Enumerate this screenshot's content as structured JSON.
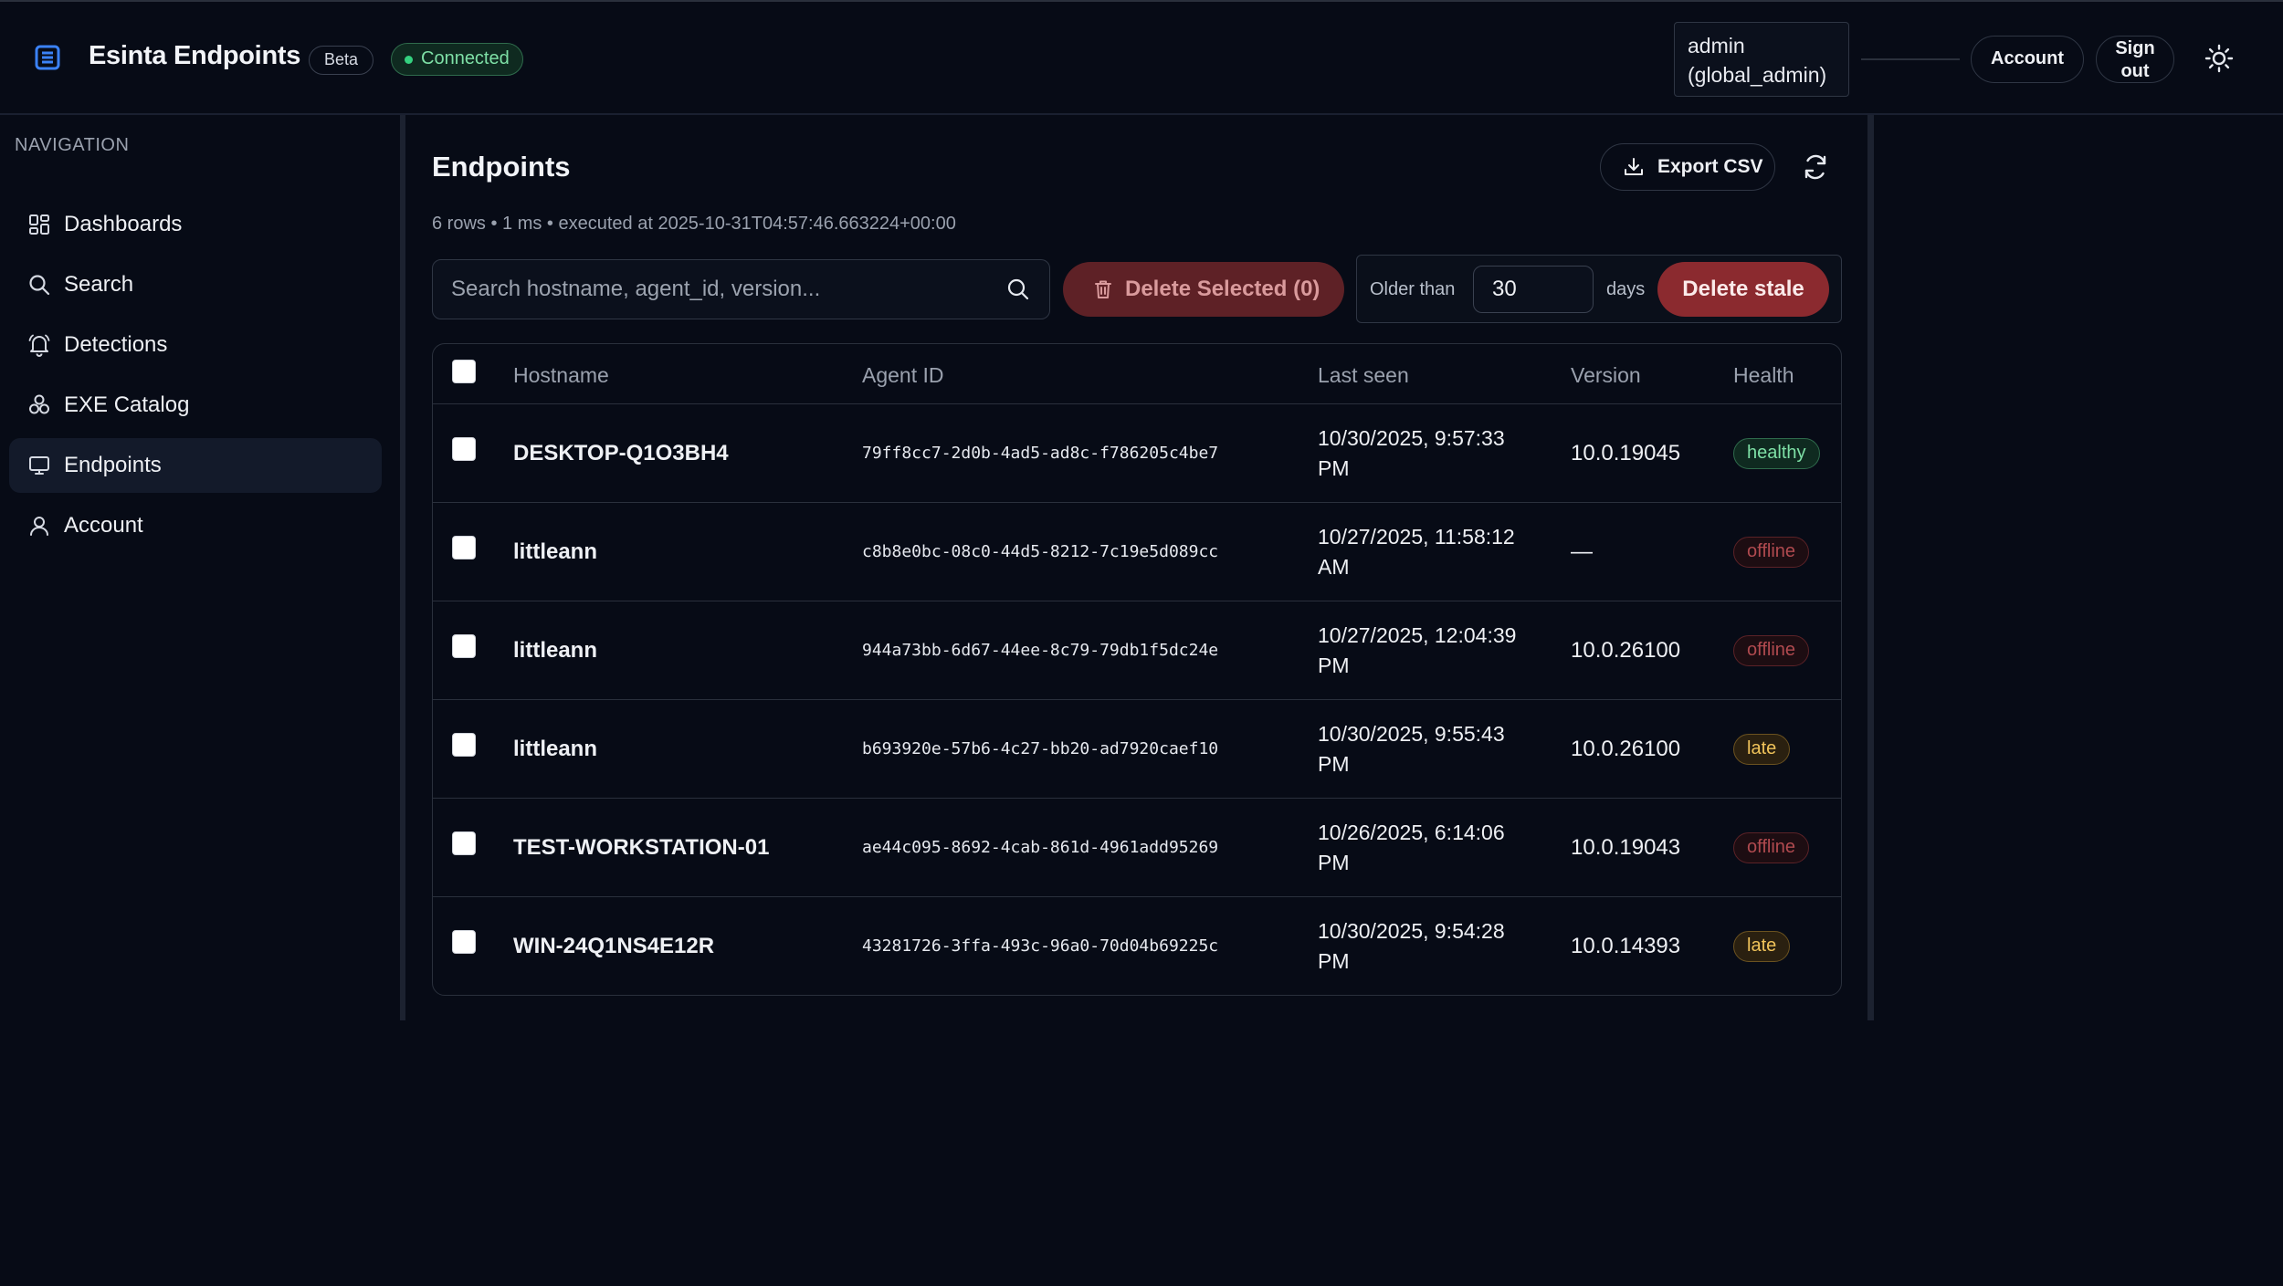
{
  "app": {
    "title": "Esinta Endpoints",
    "beta_label": "Beta",
    "status_label": "Connected"
  },
  "header": {
    "user_line1": "admin",
    "user_line2": "(global_admin)",
    "account_label": "Account",
    "signout_label": "Sign\nout",
    "theme_icon": "sun-icon"
  },
  "sidebar": {
    "heading": "NAVIGATION",
    "items": [
      {
        "label": "Dashboards",
        "icon": "dashboard-icon",
        "active": false
      },
      {
        "label": "Search",
        "icon": "search-icon",
        "active": false
      },
      {
        "label": "Detections",
        "icon": "bell-icon",
        "active": false
      },
      {
        "label": "EXE Catalog",
        "icon": "catalog-icon",
        "active": false
      },
      {
        "label": "Endpoints",
        "icon": "monitor-icon",
        "active": true
      },
      {
        "label": "Account",
        "icon": "user-icon",
        "active": false
      }
    ]
  },
  "main": {
    "title": "Endpoints",
    "meta": "6 rows • 1 ms • executed at 2025-10-31T04:57:46.663224+00:00",
    "export_label": "Export CSV",
    "search_placeholder": "Search hostname, agent_id, version...",
    "delete_selected_label": "Delete Selected (0)",
    "older_than_label": "Older than",
    "older_than_value": "30",
    "days_label": "days",
    "delete_stale_label": "Delete stale"
  },
  "table": {
    "columns": [
      "Hostname",
      "Agent ID",
      "Last seen",
      "Version",
      "Health"
    ],
    "rows": [
      {
        "hostname": "DESKTOP-Q1O3BH4",
        "agent_id": "79ff8cc7-2d0b-4ad5-ad8c-f786205c4be7",
        "last_seen": "10/30/2025, 9:57:33 PM",
        "version": "10.0.19045",
        "health": "healthy"
      },
      {
        "hostname": "littleann",
        "agent_id": "c8b8e0bc-08c0-44d5-8212-7c19e5d089cc",
        "last_seen": "10/27/2025, 11:58:12 AM",
        "version": "—",
        "health": "offline"
      },
      {
        "hostname": "littleann",
        "agent_id": "944a73bb-6d67-44ee-8c79-79db1f5dc24e",
        "last_seen": "10/27/2025, 12:04:39 PM",
        "version": "10.0.26100",
        "health": "offline"
      },
      {
        "hostname": "littleann",
        "agent_id": "b693920e-57b6-4c27-bb20-ad7920caef10",
        "last_seen": "10/30/2025, 9:55:43 PM",
        "version": "10.0.26100",
        "health": "late"
      },
      {
        "hostname": "TEST-WORKSTATION-01",
        "agent_id": "ae44c095-8692-4cab-861d-4961add95269",
        "last_seen": "10/26/2025, 6:14:06 PM",
        "version": "10.0.19043",
        "health": "offline"
      },
      {
        "hostname": "WIN-24Q1NS4E12R",
        "agent_id": "43281726-3ffa-493c-96a0-70d04b69225c",
        "last_seen": "10/30/2025, 9:54:28 PM",
        "version": "10.0.14393",
        "health": "late"
      }
    ]
  },
  "colors": {
    "background": "#070b16",
    "accent_blue": "#3b82f6",
    "healthy": "#7ee0a6",
    "offline": "#b04a4f",
    "late": "#f0c35a",
    "danger": "#8b2a2f"
  }
}
